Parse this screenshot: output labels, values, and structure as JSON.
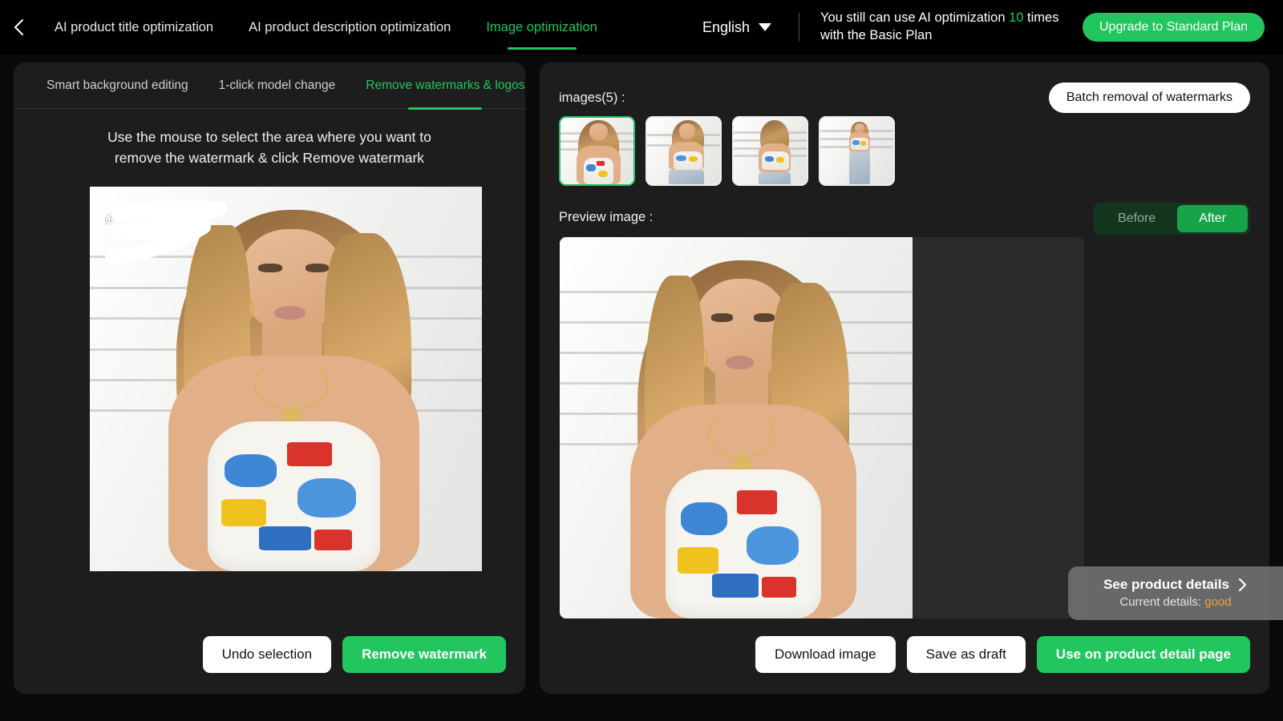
{
  "topbar": {
    "back_icon": "chevron-left-icon",
    "tabs": [
      {
        "label": "AI product title optimization",
        "active": false
      },
      {
        "label": "AI product description optimization",
        "active": false
      },
      {
        "label": "Image optimization",
        "active": true
      }
    ],
    "language": "English",
    "language_caret_icon": "chevron-down-icon",
    "quota_prefix": "You still can use AI optimization ",
    "quota_count": "10",
    "quota_suffix": " times with the Basic Plan",
    "upgrade_label": "Upgrade to Standard Plan"
  },
  "left_panel": {
    "tabs": [
      {
        "label": "Smart background editing",
        "active": false
      },
      {
        "label": "1-click model change",
        "active": false
      },
      {
        "label": "Remove watermarks & logos",
        "active": true
      }
    ],
    "hint_line1": "Use the mouse to select the area where you want to",
    "hint_line2": "remove the watermark & click Remove watermark",
    "watermark_text": "@",
    "undo_label": "Undo selection",
    "remove_label": "Remove watermark"
  },
  "right_panel": {
    "images_label": "images(5) :",
    "batch_label": "Batch removal of watermarks",
    "thumbnails": [
      {
        "name": "thumb-1",
        "selected": true
      },
      {
        "name": "thumb-2",
        "selected": false
      },
      {
        "name": "thumb-3",
        "selected": false
      },
      {
        "name": "thumb-4",
        "selected": false
      }
    ],
    "preview_label": "Preview image :",
    "toggle": {
      "before": "Before",
      "after": "After",
      "active": "After"
    },
    "download_label": "Download image",
    "save_draft_label": "Save as draft",
    "use_label": "Use on product detail page",
    "details_title": "See product details",
    "details_chevron_icon": "chevron-right-icon",
    "details_sub_prefix": "Current details: ",
    "details_sub_value": "good"
  },
  "colors": {
    "accent_green": "#22c55e",
    "accent_green_dark": "#16a34a",
    "toggle_track": "#14361f",
    "panel_bg": "#1d1d1d",
    "page_bg": "#0a0a0a",
    "preview_bg": "#2b2b2b",
    "details_value": "#e9a13b"
  }
}
